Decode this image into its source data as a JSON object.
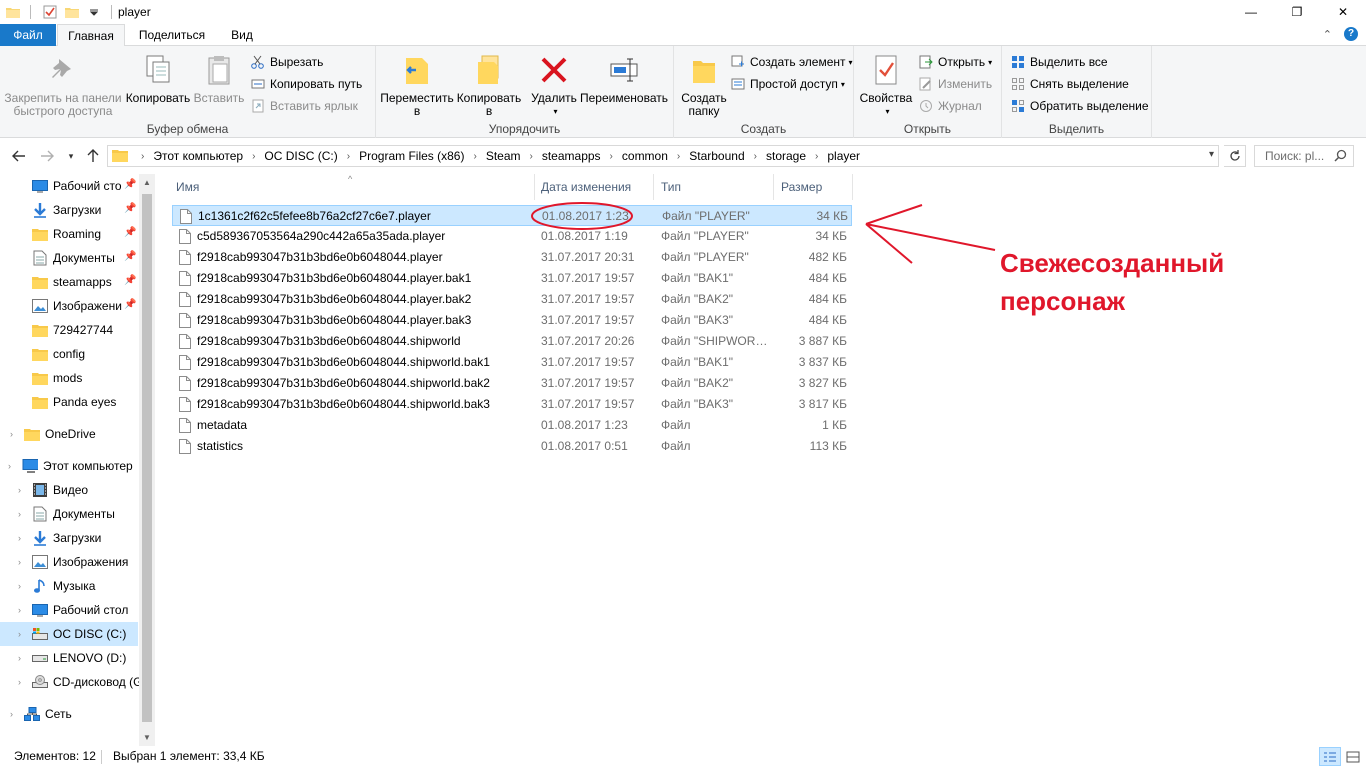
{
  "window": {
    "title": "player",
    "controls": {
      "minimize": "—",
      "maximize": "❐",
      "close": "✕"
    }
  },
  "tabs": {
    "file": "Файл",
    "home": "Главная",
    "share": "Поделиться",
    "view": "Вид",
    "collapse": "⌃",
    "help": "?"
  },
  "ribbon": {
    "clipboard": {
      "label": "Буфер обмена",
      "pin_quick": "Закрепить на панели быстрого доступа",
      "copy": "Копировать",
      "paste": "Вставить",
      "cut": "Вырезать",
      "copy_path": "Копировать путь",
      "paste_shortcut": "Вставить ярлык"
    },
    "organize": {
      "label": "Упорядочить",
      "move_to": "Переместить в",
      "copy_to": "Копировать в",
      "delete": "Удалить",
      "rename": "Переименовать"
    },
    "new": {
      "label": "Создать",
      "new_folder": "Создать папку",
      "new_item": "Создать элемент",
      "easy_access": "Простой доступ"
    },
    "open": {
      "label": "Открыть",
      "properties": "Свойства",
      "open": "Открыть",
      "edit": "Изменить",
      "history": "Журнал"
    },
    "select": {
      "label": "Выделить",
      "select_all": "Выделить все",
      "select_none": "Снять выделение",
      "invert": "Обратить выделение"
    }
  },
  "address": {
    "crumbs": [
      "Этот компьютер",
      "OC DISC (C:)",
      "Program Files (x86)",
      "Steam",
      "steamapps",
      "common",
      "Starbound",
      "storage",
      "player"
    ],
    "search_placeholder": "Поиск: pl..."
  },
  "navpane": {
    "quick": [
      {
        "label": "Рабочий сто",
        "icon": "desktop-icon",
        "pinned": true
      },
      {
        "label": "Загрузки",
        "icon": "downloads-icon",
        "pinned": true
      },
      {
        "label": "Roaming",
        "icon": "folder-icon",
        "pinned": true
      },
      {
        "label": "Документы",
        "icon": "documents-icon",
        "pinned": true
      },
      {
        "label": "steamapps",
        "icon": "folder-icon",
        "pinned": true
      },
      {
        "label": "Изображени",
        "icon": "pictures-icon",
        "pinned": true
      },
      {
        "label": "729427744",
        "icon": "folder-icon",
        "pinned": false
      },
      {
        "label": "config",
        "icon": "folder-icon",
        "pinned": false
      },
      {
        "label": "mods",
        "icon": "folder-icon",
        "pinned": false
      },
      {
        "label": "Panda eyes",
        "icon": "folder-icon",
        "pinned": false
      }
    ],
    "onedrive": "OneDrive",
    "this_pc": "Этот компьютер",
    "pc_items": [
      {
        "label": "Видео",
        "icon": "video-icon"
      },
      {
        "label": "Документы",
        "icon": "documents-icon"
      },
      {
        "label": "Загрузки",
        "icon": "downloads-icon"
      },
      {
        "label": "Изображения",
        "icon": "pictures-icon"
      },
      {
        "label": "Музыка",
        "icon": "music-icon"
      },
      {
        "label": "Рабочий стол",
        "icon": "desktop-icon"
      },
      {
        "label": "OC DISC (C:)",
        "icon": "system-drive-icon",
        "selected": true
      },
      {
        "label": "LENOVO (D:)",
        "icon": "drive-icon"
      },
      {
        "label": "CD-дисковод (G",
        "icon": "cd-drive-icon"
      }
    ],
    "network": "Сеть"
  },
  "filelist": {
    "columns": {
      "name": "Имя",
      "date": "Дата изменения",
      "type": "Тип",
      "size": "Размер"
    },
    "rows": [
      {
        "name": "1c1361c2f62c5fefee8b76a2cf27c6e7.player",
        "date": "01.08.2017 1:23",
        "type": "Файл \"PLAYER\"",
        "size": "34 КБ",
        "selected": true
      },
      {
        "name": "c5d589367053564a290c442a65a35ada.player",
        "date": "01.08.2017 1:19",
        "type": "Файл \"PLAYER\"",
        "size": "34 КБ"
      },
      {
        "name": "f2918cab993047b31b3bd6e0b6048044.player",
        "date": "31.07.2017 20:31",
        "type": "Файл \"PLAYER\"",
        "size": "482 КБ"
      },
      {
        "name": "f2918cab993047b31b3bd6e0b6048044.player.bak1",
        "date": "31.07.2017 19:57",
        "type": "Файл \"BAK1\"",
        "size": "484 КБ"
      },
      {
        "name": "f2918cab993047b31b3bd6e0b6048044.player.bak2",
        "date": "31.07.2017 19:57",
        "type": "Файл \"BAK2\"",
        "size": "484 КБ"
      },
      {
        "name": "f2918cab993047b31b3bd6e0b6048044.player.bak3",
        "date": "31.07.2017 19:57",
        "type": "Файл \"BAK3\"",
        "size": "484 КБ"
      },
      {
        "name": "f2918cab993047b31b3bd6e0b6048044.shipworld",
        "date": "31.07.2017 20:26",
        "type": "Файл \"SHIPWORL...",
        "size": "3 887 КБ"
      },
      {
        "name": "f2918cab993047b31b3bd6e0b6048044.shipworld.bak1",
        "date": "31.07.2017 19:57",
        "type": "Файл \"BAK1\"",
        "size": "3 837 КБ"
      },
      {
        "name": "f2918cab993047b31b3bd6e0b6048044.shipworld.bak2",
        "date": "31.07.2017 19:57",
        "type": "Файл \"BAK2\"",
        "size": "3 827 КБ"
      },
      {
        "name": "f2918cab993047b31b3bd6e0b6048044.shipworld.bak3",
        "date": "31.07.2017 19:57",
        "type": "Файл \"BAK3\"",
        "size": "3 817 КБ"
      },
      {
        "name": "metadata",
        "date": "01.08.2017 1:23",
        "type": "Файл",
        "size": "1 КБ"
      },
      {
        "name": "statistics",
        "date": "01.08.2017 0:51",
        "type": "Файл",
        "size": "113 КБ"
      }
    ]
  },
  "annotation": {
    "line1": "Свежесозданный",
    "line2": "персонаж",
    "color": "#e0172b"
  },
  "status": {
    "count": "Элементов: 12",
    "selection": "Выбран 1 элемент: 33,4 КБ"
  },
  "colors": {
    "accent": "#1979ca",
    "selection": "#cce8ff",
    "selection_border": "#99d1ff"
  }
}
